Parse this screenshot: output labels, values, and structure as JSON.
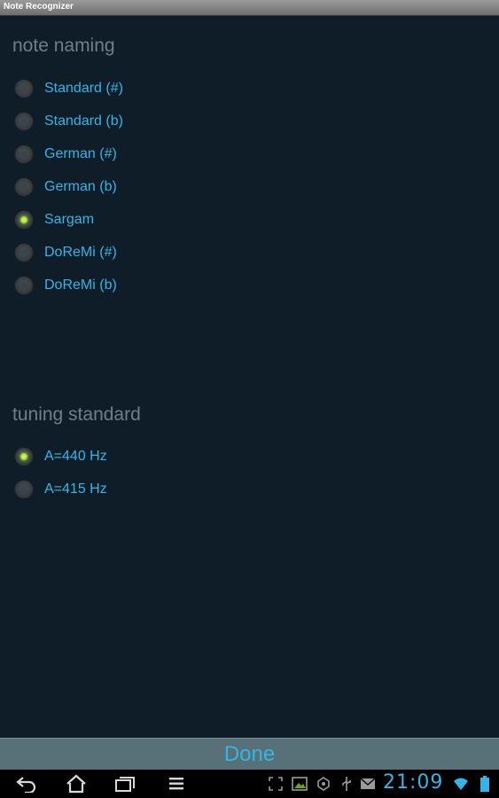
{
  "window": {
    "title": "Note Recognizer"
  },
  "note_naming": {
    "title": "note naming",
    "options": [
      {
        "label": "Standard (#)",
        "checked": false
      },
      {
        "label": "Standard (b)",
        "checked": false
      },
      {
        "label": "German (#)",
        "checked": false
      },
      {
        "label": "German (b)",
        "checked": false
      },
      {
        "label": "Sargam",
        "checked": true
      },
      {
        "label": "DoReMi (#)",
        "checked": false
      },
      {
        "label": "DoReMi (b)",
        "checked": false
      }
    ]
  },
  "tuning_standard": {
    "title": "tuning standard",
    "options": [
      {
        "label": "A=440 Hz",
        "checked": true
      },
      {
        "label": "A=415 Hz",
        "checked": false
      }
    ]
  },
  "done_button": {
    "label": "Done"
  },
  "status_bar": {
    "time": "21:09",
    "icons": [
      "screenshot-icon",
      "gallery-icon",
      "android-debug-icon",
      "usb-icon",
      "mail-icon",
      "wifi-icon",
      "battery-icon"
    ]
  },
  "nav_buttons": [
    "back-icon",
    "home-icon",
    "recent-apps-icon",
    "menu-icon"
  ],
  "colors": {
    "background": "#0f1d29",
    "label": "#35b5e5",
    "section_title": "#6e7f8c",
    "accent": "#33b5e5",
    "radio_checked": "#a6e22a",
    "done_bar": "#587078"
  }
}
